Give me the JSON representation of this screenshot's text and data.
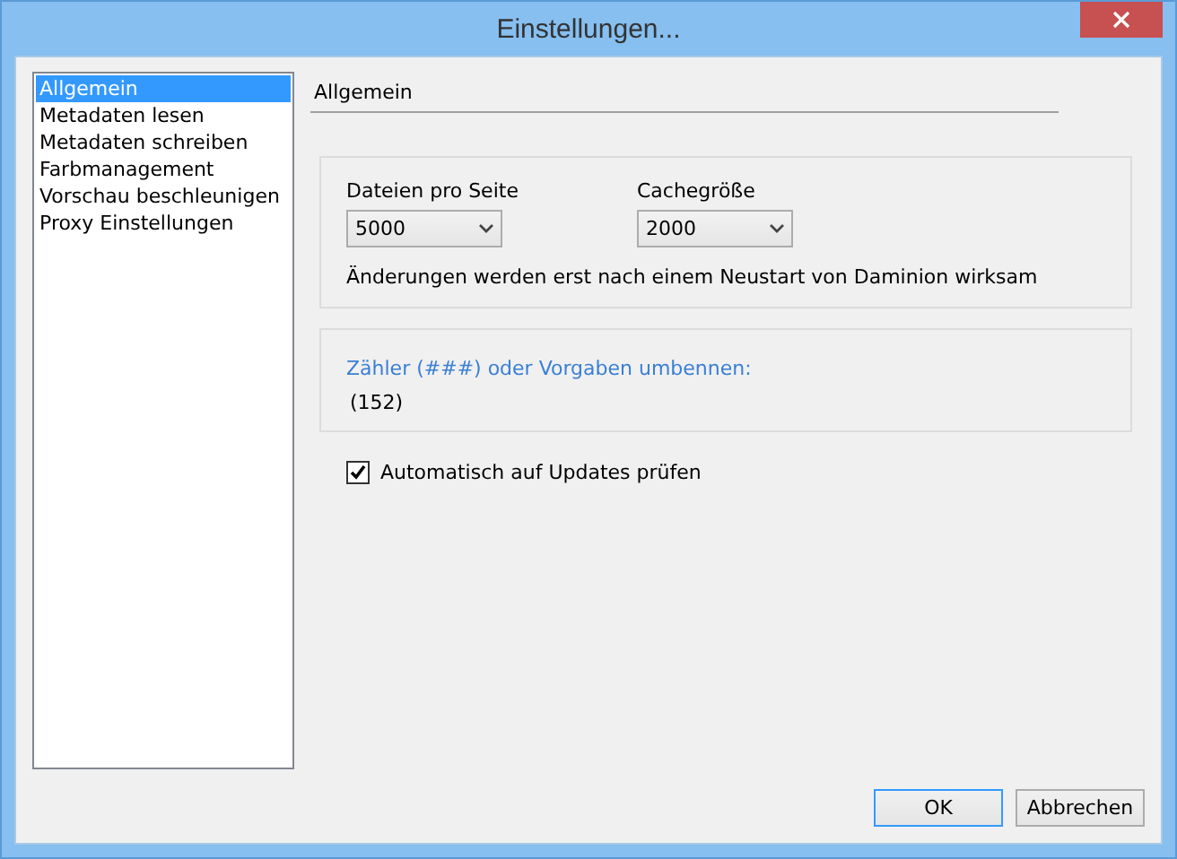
{
  "window": {
    "title": "Einstellungen..."
  },
  "sidebar": {
    "items": [
      {
        "label": "Allgemein",
        "selected": true
      },
      {
        "label": "Metadaten lesen",
        "selected": false
      },
      {
        "label": "Metadaten schreiben",
        "selected": false
      },
      {
        "label": "Farbmanagement",
        "selected": false
      },
      {
        "label": "Vorschau beschleunigen",
        "selected": false
      },
      {
        "label": "Proxy Einstellungen",
        "selected": false
      }
    ]
  },
  "section_title": "Allgemein",
  "cache_group": {
    "dropdowns": [
      {
        "label": "Dateien pro Seite",
        "value": "5000"
      },
      {
        "label": "Cachegröße",
        "value": "2000"
      }
    ],
    "note": "Änderungen werden erst nach einem Neustart von Daminion wirksam"
  },
  "counter_group": {
    "link": "Zähler (###) oder Vorgaben umbennen:",
    "value": "(152)"
  },
  "auto_update": {
    "label": "Automatisch auf Updates prüfen",
    "checked": true
  },
  "buttons": [
    {
      "label": "OK",
      "default": true
    },
    {
      "label": "Abbrechen",
      "default": false
    }
  ]
}
